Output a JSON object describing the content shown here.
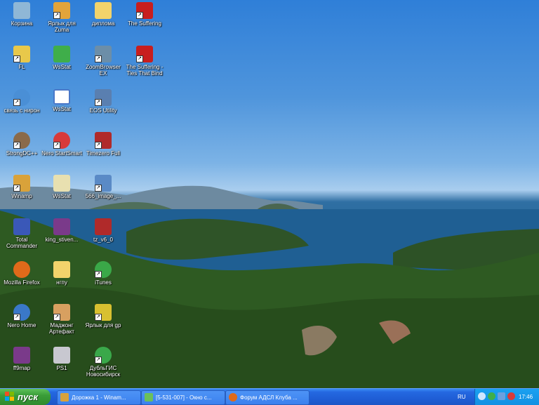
{
  "desktop": {
    "icons": [
      {
        "label": "Корзина",
        "icon": "recycle-bin-icon",
        "color": "#8fb7d6"
      },
      {
        "label": "Ярлык для Zuma",
        "icon": "zuma-icon",
        "color": "#e2a43a"
      },
      {
        "label": "диплома",
        "icon": "folder-icon",
        "color": "#f2d36b"
      },
      {
        "label": "The Suffering",
        "icon": "riddick-game-icon",
        "color": "#c81e1e"
      },
      {
        "label": "FL",
        "icon": "fl-studio-icon",
        "color": "#e8c84a"
      },
      {
        "label": "WsStat",
        "icon": "wsstat-icon",
        "color": "#3fae4a"
      },
      {
        "label": "ZoomBrowser EX",
        "icon": "zoombrowser-icon",
        "color": "#6c8ea8"
      },
      {
        "label": "The Suffering - Ties That Bind",
        "icon": "riddick-game-icon",
        "color": "#c81e1e"
      },
      {
        "label": "связь с нирон",
        "icon": "network-connection-icon",
        "color": "#4a8fd6"
      },
      {
        "label": "WsStat",
        "icon": "window-icon",
        "color": "#4a78c8"
      },
      {
        "label": "EOS Utility",
        "icon": "camera-icon",
        "color": "#5a7fb0"
      },
      {
        "label": "StrongDC++",
        "icon": "strongdc-icon",
        "color": "#8a6a4a"
      },
      {
        "label": "Nero StartSmart",
        "icon": "nero-icon",
        "color": "#d83a3a"
      },
      {
        "label": "Timezero Full",
        "icon": "timezero-icon",
        "color": "#b02a2a"
      },
      {
        "label": "Winamp",
        "icon": "winamp-icon",
        "color": "#d9a23a"
      },
      {
        "label": "WsStat",
        "icon": "notepad-icon",
        "color": "#e8e0b0"
      },
      {
        "label": "566_image_...",
        "icon": "image-file-icon",
        "color": "#5a8ac6"
      },
      {
        "label": "Total Commander",
        "icon": "floppy-icon",
        "color": "#3a58b8"
      },
      {
        "label": "king_stiven...",
        "icon": "archive-icon",
        "color": "#7a3a8a"
      },
      {
        "label": "tz_v6_0",
        "icon": "timezero-icon",
        "color": "#b02a2a"
      },
      {
        "label": "Mozilla Firefox",
        "icon": "firefox-icon",
        "color": "#e06a1a"
      },
      {
        "label": "нгпу",
        "icon": "folder-icon",
        "color": "#f2d36b"
      },
      {
        "label": "iTunes",
        "icon": "itunes-icon",
        "color": "#3aa848"
      },
      {
        "label": "Nero Home",
        "icon": "nero-home-icon",
        "color": "#3a78c8"
      },
      {
        "label": "Маджонг Артефакт",
        "icon": "mahjong-icon",
        "color": "#d8a060"
      },
      {
        "label": "Ярлык для gp",
        "icon": "gp-icon",
        "color": "#d8c030"
      },
      {
        "label": "ff9map",
        "icon": "archive-icon",
        "color": "#7a3a8a"
      },
      {
        "label": "PS1",
        "icon": "gamepad-icon",
        "color": "#c8c8d0"
      },
      {
        "label": "ДубльГИС Новосибирск",
        "icon": "dublgis-icon",
        "color": "#3aa84a"
      }
    ]
  },
  "taskbar": {
    "start_label": "пуск",
    "tasks": [
      {
        "label": "Дорожка 1 - Winam...",
        "icon": "winamp-icon",
        "color": "#d9a23a"
      },
      {
        "label": "[5-531-007] - Окно с...",
        "icon": "app-window-icon",
        "color": "#6cc05a"
      },
      {
        "label": "Форум АДСЛ Клуба ...",
        "icon": "firefox-icon",
        "color": "#e06a1a"
      }
    ],
    "tray": {
      "language": "RU",
      "clock": "17:46",
      "icons": [
        {
          "name": "back-arrow-icon",
          "color": "#cfe6ff"
        },
        {
          "name": "wsstat-tray-icon",
          "color": "#3fae4a"
        },
        {
          "name": "network-tray-icon",
          "color": "#6aa0e0"
        },
        {
          "name": "security-tray-icon",
          "color": "#d83a3a"
        }
      ]
    }
  }
}
